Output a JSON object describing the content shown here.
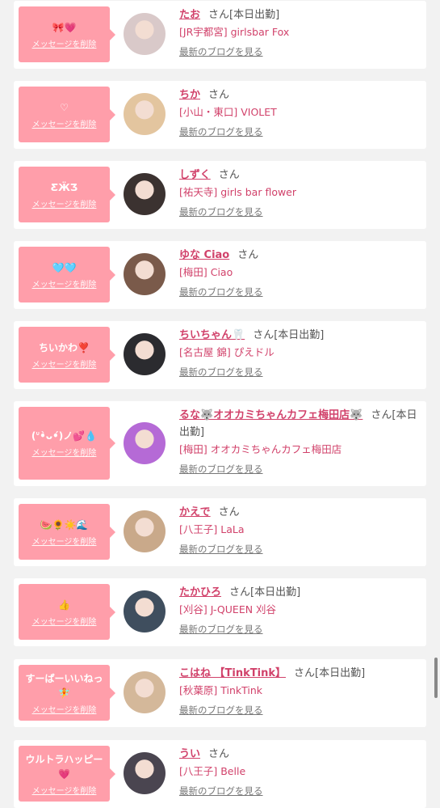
{
  "delete_label": "メッセージを削除",
  "blog_label": "最新のブログを見る",
  "suffix": "さん",
  "accent_pink": "#ff9eaa",
  "name_color": "#d1416a",
  "items": [
    {
      "msg": "🎀💗",
      "name": "たお",
      "status": "[本日出勤]",
      "shop": "[JR宇都宮] girlsbar Fox",
      "avatar_color": "#d9c9c9"
    },
    {
      "msg": "♡",
      "name": "ちか",
      "status": "",
      "shop": "[小山・東口] VIOLET",
      "avatar_color": "#e3c59f"
    },
    {
      "msg": "ƸӜƷ",
      "name": "しずく",
      "status": "",
      "shop": "[祐天寺] girls bar flower",
      "avatar_color": "#3b3230"
    },
    {
      "msg": "🩵🩵",
      "name": "ゆな Ciao",
      "status": "",
      "shop": "[梅田] Ciao",
      "avatar_color": "#7a5a4a"
    },
    {
      "msg": "ちいかわ❣️",
      "name": "ちいちゃん🦷",
      "status": "[本日出勤]",
      "shop": "[名古屋 錦] ぴえドル",
      "avatar_color": "#2b2b2f"
    },
    {
      "msg": "(ᐡ•̀ᴗ•́)ノ💕💧",
      "name": "るな🐺オオカミちゃんカフェ梅田店🐺",
      "status": "[本日出勤]",
      "shop": "[梅田] オオカミちゃんカフェ梅田店",
      "avatar_color": "#b56ad6"
    },
    {
      "msg": "🍉🌻☀️🌊",
      "name": "かえで",
      "status": "",
      "shop": "[八王子] LaLa",
      "avatar_color": "#c9a98a"
    },
    {
      "msg": "👍",
      "name": "たかひろ",
      "status": "[本日出勤]",
      "shop": "[刈谷] J-QUEEN 刈谷",
      "avatar_color": "#3f4e5e"
    },
    {
      "msg": "すーぱーいいねっ\n🧚",
      "name": "こはね 【TinkTink】",
      "status": "[本日出勤]",
      "shop": "[秋葉原] TinkTink",
      "avatar_color": "#d4b89a"
    },
    {
      "msg": "ウルトラハッピー\n💗",
      "name": "うい",
      "status": "",
      "shop": "[八王子] Belle",
      "avatar_color": "#4a4550"
    }
  ]
}
